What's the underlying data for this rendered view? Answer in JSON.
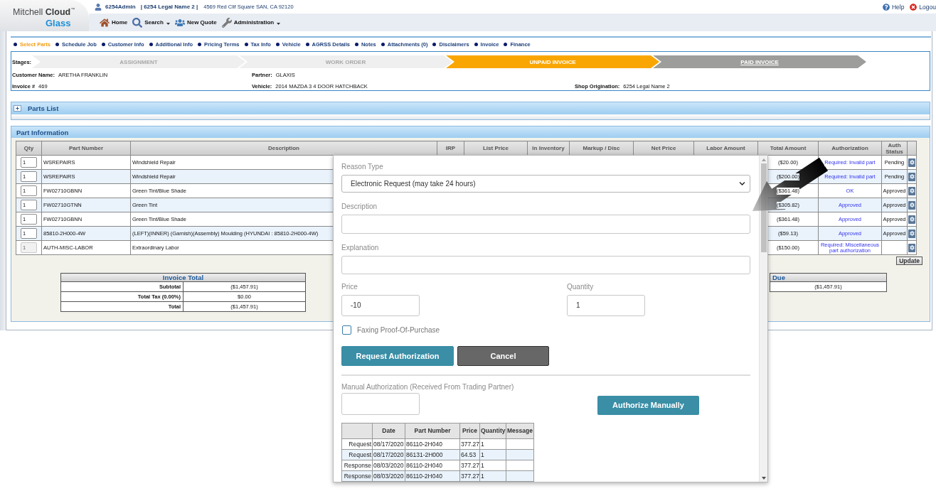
{
  "header": {
    "logo": {
      "wordmark": "Mitchell **Cloud**$^{™}$",
      "product": "Glass"
    },
    "user": {
      "name": "6254Admin",
      "company": "| 6254 Legal Name 2 |",
      "address": "4569 Red Clif Square SAN, CA 92120"
    },
    "links": [
      {
        "label": "Help"
      },
      {
        "label": "Logou"
      }
    ],
    "nav": [
      {
        "label": "Home",
        "has_menu": false
      },
      {
        "label": "Search",
        "has_menu": true
      },
      {
        "label": "New Quote",
        "has_menu": false
      },
      {
        "label": "Administration",
        "has_menu": true
      }
    ]
  },
  "steps": [
    {
      "label": "Select Parts",
      "selected": true
    },
    {
      "label": "Schedule Job",
      "selected": false
    },
    {
      "label": "Customer Info",
      "selected": false
    },
    {
      "label": "Additional Info",
      "selected": false
    },
    {
      "label": "Pricing Terms",
      "selected": false
    },
    {
      "label": "Tax Info",
      "selected": false
    },
    {
      "label": "Vehicle",
      "selected": false
    },
    {
      "label": "AGRSS Details",
      "selected": false
    },
    {
      "label": "Notes",
      "selected": false
    },
    {
      "label": "Attachments (0)",
      "selected": false
    },
    {
      "label": "Disclaimers",
      "selected": false
    },
    {
      "label": "Invoice",
      "selected": false
    },
    {
      "label": "Finance",
      "selected": false
    }
  ],
  "stages": {
    "label": "Stages:",
    "items": [
      {
        "label": "ASSIGNMENT",
        "selected": false,
        "disabled": true
      },
      {
        "label": "WORK ORDER",
        "selected": false,
        "disabled": true
      },
      {
        "label": "UNPAID INVOICE",
        "selected": true,
        "disabled": false
      },
      {
        "label": "PAID INVOICE",
        "selected": false,
        "disabled": false
      }
    ]
  },
  "job_info": {
    "customer_name": {
      "label": "Customer Name:",
      "value": "ARETHA FRANKLIN"
    },
    "partner": {
      "label": "Partner:",
      "value": "GLAXIS"
    },
    "invoice": {
      "label": "Invoice #",
      "value": "469"
    },
    "vehicle": {
      "label": "Vehicle:",
      "value": "2014 MAZDA 3 4 DOOR HATCHBACK"
    },
    "shop_origination": {
      "label": "Shop Origination:",
      "value": "6254 Legal Name 2"
    }
  },
  "parts_list": {
    "title": "Parts List",
    "expanded": false
  },
  "part_information": {
    "title": "Part Information",
    "columns": [
      "Qty",
      "Part Number",
      "Description",
      "IRP",
      "List Price",
      "In Inventory",
      "Markup / Disc",
      "Net Price",
      "Labor Amount",
      "Total Amount",
      "Authorization",
      "Auth Status"
    ],
    "rows": [
      {
        "qty": "1",
        "qty_disabled": false,
        "part_number": "WSREPAIRS",
        "description": "Windshield Repair",
        "total_amount": "($20.00)",
        "authorization": "Required: Invalid part",
        "auth_status": "Pending"
      },
      {
        "qty": "1",
        "qty_disabled": false,
        "part_number": "WSREPAIRS",
        "description": "Windshield Repair",
        "total_amount": "($200.00)",
        "authorization": "Required: Invalid part",
        "auth_status": "Pending"
      },
      {
        "qty": "1",
        "qty_disabled": false,
        "part_number": "FW02710GBNN",
        "description": "Green Tint/Blue Shade",
        "total_amount": "($361.48)",
        "authorization": "OK",
        "auth_status": "Approved"
      },
      {
        "qty": "1",
        "qty_disabled": false,
        "part_number": "FW02710GTNN",
        "description": "Green Tint",
        "total_amount": "($305.82)",
        "authorization": "Approved",
        "auth_status": "Approved"
      },
      {
        "qty": "1",
        "qty_disabled": false,
        "part_number": "FW02710GBNN",
        "description": "Green Tint/Blue Shade",
        "total_amount": "($361.48)",
        "authorization": "Approved",
        "auth_status": "Approved"
      },
      {
        "qty": "1",
        "qty_disabled": false,
        "part_number": "85810-2H000-4W",
        "description": "(LEFT)(INNER) (Garnish)(Assembly) Moulding (HYUNDAI : 85810-2H000-4W)",
        "total_amount": "($59.13)",
        "authorization": "Approved",
        "auth_status": "Approved"
      },
      {
        "qty": "1",
        "qty_disabled": true,
        "part_number": "AUTH-MISC-LABOR",
        "description": "Extraordinary Labor",
        "total_amount": "($150.00)",
        "authorization": "Required: Miscellaneous part authorization"
      }
    ],
    "update_button": "Update",
    "invoice_total": {
      "title": "Invoice Total",
      "rows": [
        {
          "label": "Subtotal",
          "value": "($1,457.91)"
        },
        {
          "label": "Total Tax (0.00%)",
          "value": "$0.00"
        },
        {
          "label": "Total",
          "value": "($1,457.91)"
        }
      ]
    },
    "due_total": {
      "title": "Due",
      "value": "($1,457.91)"
    }
  },
  "authorization_dialog": {
    "reason_type": {
      "label": "Reason Type",
      "value": "Electronic Request (may take 24 hours)"
    },
    "description": {
      "label": "Description"
    },
    "explanation": {
      "label": "Explanation"
    },
    "price": {
      "label": "Price",
      "value": "-10"
    },
    "quantity": {
      "label": "Quantity",
      "value": "1"
    },
    "faxing_proof_of_purchase": {
      "label": "Faxing Proof-Of-Purchase",
      "checked": false
    },
    "buttons": [
      {
        "label": "Request Authorization",
        "kind": "primary"
      },
      {
        "label": "Cancel",
        "kind": "secondary"
      }
    ],
    "manual_authorization": {
      "label": "Manual Authorization (Received From Trading Partner)",
      "button": "Authorize Manually"
    },
    "history": {
      "columns": [
        "Date",
        "Part Number",
        "Price",
        "Quantity",
        "Message"
      ],
      "rows": [
        {
          "event": "Request",
          "date": "08/17/2020",
          "part_number": "86110-2H040",
          "price": "377.27",
          "quantity": "1"
        },
        {
          "event": "Request",
          "date": "08/17/2020",
          "part_number": "86131-2H000",
          "price": "64.53",
          "quantity": "1"
        },
        {
          "event": "Response",
          "date": "08/03/2020",
          "part_number": "86110-2H040",
          "price": "377.27",
          "quantity": "1"
        },
        {
          "event": "Response",
          "date": "08/03/2020",
          "part_number": "86110-2H040",
          "price": "377.27",
          "quantity": "1"
        }
      ]
    }
  }
}
